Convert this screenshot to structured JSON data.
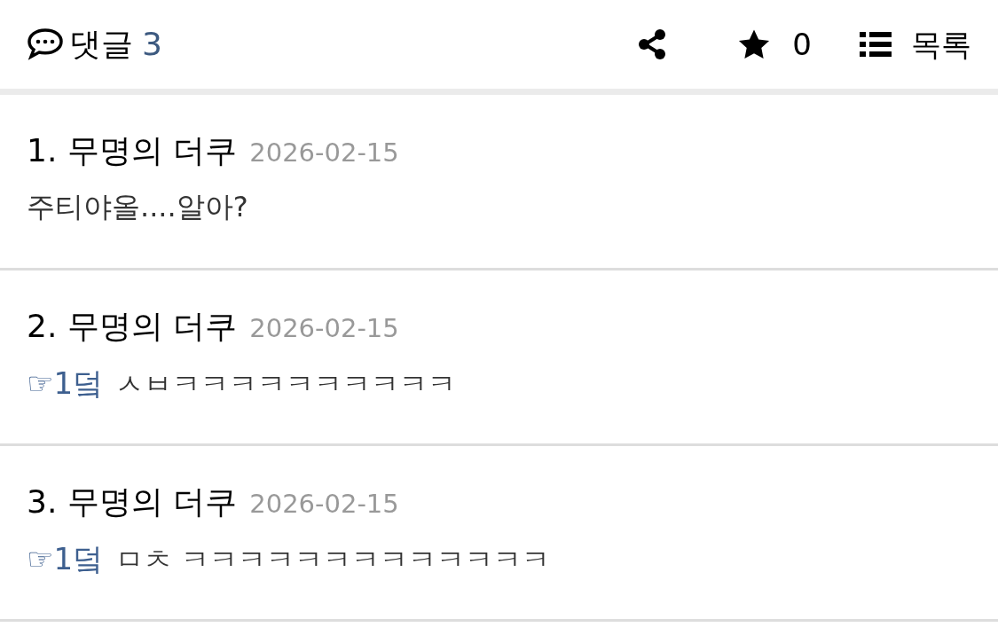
{
  "header": {
    "label": "댓글",
    "count": "3",
    "star_count": "0",
    "list_label": "목록"
  },
  "comments": [
    {
      "number": "1.",
      "author": "무명의 더쿠",
      "date": "2026-02-15",
      "text": "주티야올....알아?"
    },
    {
      "number": "2.",
      "author": "무명의 더쿠",
      "date": "2026-02-15",
      "reply_to": "☞1덬",
      "text": "ㅅㅂㅋㅋㅋㅋㅋㅋㅋㅋㅋㅋ"
    },
    {
      "number": "3.",
      "author": "무명의 더쿠",
      "date": "2026-02-15",
      "reply_to": "☞1덬",
      "text": "ㅁㅊ ㅋㅋㅋㅋㅋㅋㅋㅋㅋㅋㅋㅋㅋ"
    }
  ]
}
